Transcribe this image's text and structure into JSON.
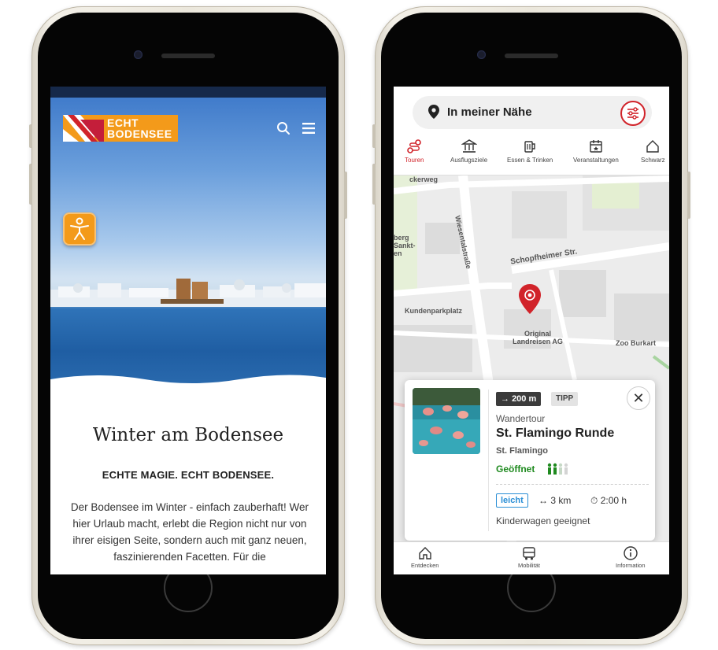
{
  "left_phone": {
    "logo": {
      "line1": "ECHT",
      "line2": "BODENSEE"
    },
    "title": "Winter am Bodensee",
    "subtitle": "ECHTE MAGIE. ECHT BODENSEE.",
    "body": "Der Bodensee im Winter - einfach zauberhaft! Wer hier Urlaub macht, erlebt die Region nicht nur von ihrer eisigen Seite, sondern auch mit ganz neuen, faszinierenden Facetten. Für die"
  },
  "right_phone": {
    "search_label": "In meiner Nähe",
    "categories": [
      {
        "label": "Touren",
        "icon": "route-icon"
      },
      {
        "label": "Ausflugsziele",
        "icon": "museum-icon"
      },
      {
        "label": "Essen & Trinken",
        "icon": "beer-icon"
      },
      {
        "label": "Veranstaltungen",
        "icon": "calendar-icon"
      },
      {
        "label": "Schwarz",
        "icon": "house-icon"
      }
    ],
    "map_labels": {
      "street1": "Wiesentalstraße",
      "street2": "Schopfheimer Str.",
      "street3": "ckerweg",
      "parking": "Kundenparkplatz",
      "shop1_line1": "Original",
      "shop1_line2": "Landreisen AG",
      "shop2": "Zoo Burkart",
      "area_l1": "berg",
      "area_l2": "Sankt-",
      "area_l3": "en"
    },
    "card": {
      "distance": "200 m",
      "tip": "TIPP",
      "type": "Wandertour",
      "name": "St. Flamingo Runde",
      "place": "St. Flamingo",
      "status": "Geöffnet",
      "level": "leicht",
      "length": "3 km",
      "duration": "2:00 h",
      "feature": "Kinderwagen geeignet"
    },
    "bottom_nav": [
      {
        "label": "Entdecken",
        "icon": "home-icon"
      },
      {
        "label": "Mobilität",
        "icon": "bus-icon"
      },
      {
        "label": "Information",
        "icon": "info-icon"
      }
    ]
  },
  "colors": {
    "accent_red": "#d1232a",
    "brand_orange": "#f39a1a",
    "open_green": "#1f8a1f",
    "level_blue": "#2b8fd6"
  }
}
